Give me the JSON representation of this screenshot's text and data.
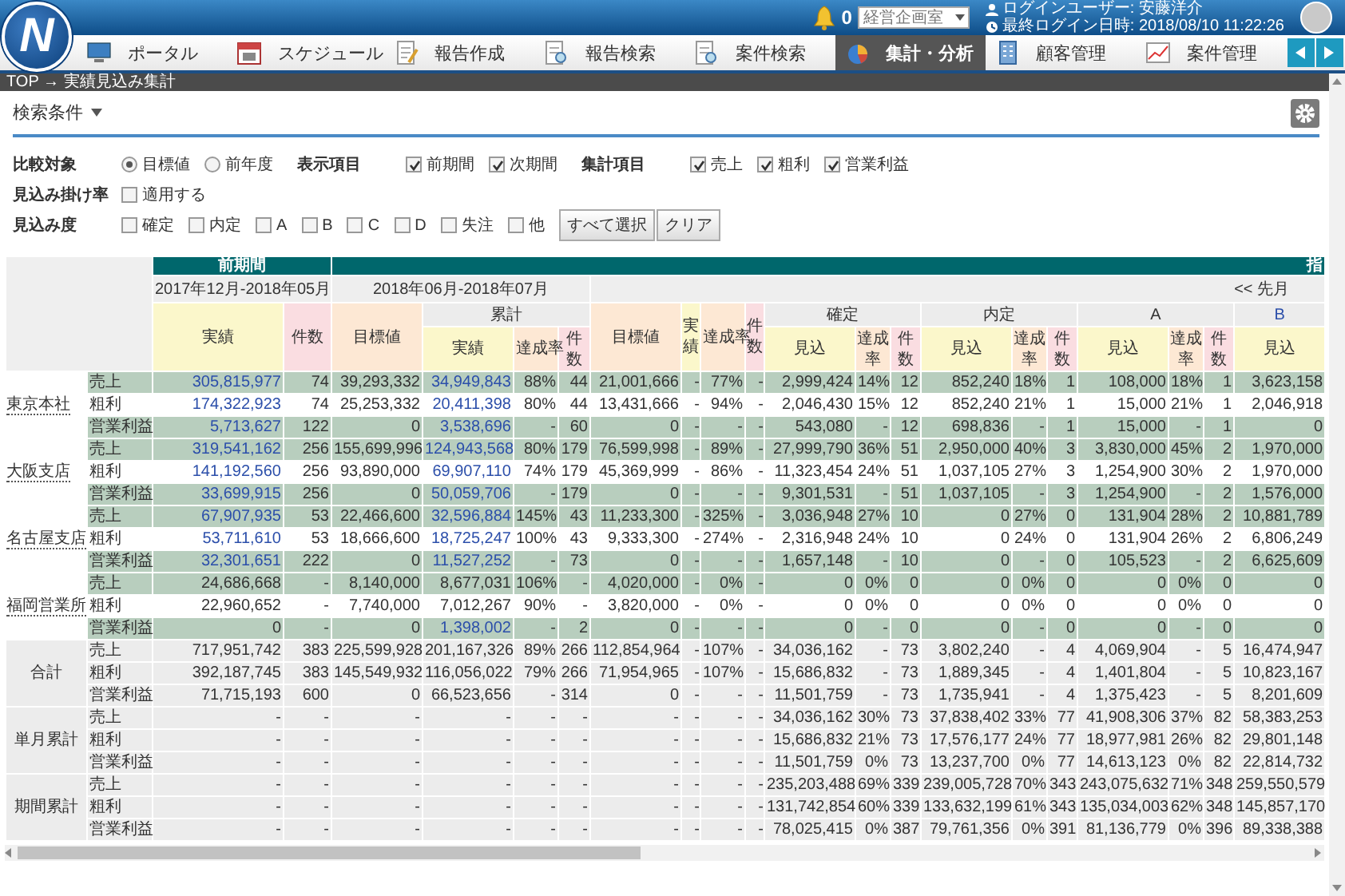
{
  "header": {
    "logo": "N",
    "notifications": "0",
    "department": "経営企画室",
    "user": "ログインユーザー: 安藤洋介",
    "last_login": "最終ログイン日時: 2018/08/10 11:22:26"
  },
  "nav": [
    {
      "label": "ポータル",
      "selected": false
    },
    {
      "label": "スケジュール",
      "selected": false
    },
    {
      "label": "報告作成",
      "selected": false
    },
    {
      "label": "報告検索",
      "selected": false
    },
    {
      "label": "案件検索",
      "selected": false
    },
    {
      "label": "集計・分析",
      "selected": true
    },
    {
      "label": "顧客管理",
      "selected": false
    },
    {
      "label": "案件管理",
      "selected": false
    }
  ],
  "breadcrumb": "TOP → 実績見込み集計",
  "search": {
    "title": "検索条件",
    "filters": [
      {
        "label": "比較対象",
        "options": [
          {
            "kind": "radio",
            "text": "目標値",
            "selected": true
          },
          {
            "kind": "radio",
            "text": "前年度",
            "selected": false
          }
        ]
      },
      {
        "label": "表示項目",
        "options": [
          {
            "kind": "checkbox",
            "text": "前期間",
            "checked": true
          },
          {
            "kind": "checkbox",
            "text": "次期間",
            "checked": true
          }
        ]
      },
      {
        "label": "集計項目",
        "options": [
          {
            "kind": "checkbox",
            "text": "売上",
            "checked": true
          },
          {
            "kind": "checkbox",
            "text": "粗利",
            "checked": true
          },
          {
            "kind": "checkbox",
            "text": "営業利益",
            "checked": true
          }
        ]
      },
      {
        "label": "見込み掛け率",
        "options": [
          {
            "kind": "checkbox",
            "text": "適用する",
            "checked": false
          }
        ]
      },
      {
        "label": "見込み度",
        "options": [
          {
            "kind": "checkbox",
            "text": "確定",
            "checked": false
          },
          {
            "kind": "checkbox",
            "text": "内定",
            "checked": false
          },
          {
            "kind": "checkbox",
            "text": "A",
            "checked": false
          },
          {
            "kind": "checkbox",
            "text": "B",
            "checked": false
          },
          {
            "kind": "checkbox",
            "text": "C",
            "checked": false
          },
          {
            "kind": "checkbox",
            "text": "D",
            "checked": false
          },
          {
            "kind": "checkbox",
            "text": "失注",
            "checked": false
          },
          {
            "kind": "checkbox",
            "text": "他",
            "checked": false
          },
          {
            "kind": "button",
            "text": "すべて選択"
          },
          {
            "kind": "button",
            "text": "クリア"
          }
        ]
      }
    ]
  },
  "table": {
    "periods": [
      {
        "title": "前期間",
        "spans": [
          {
            "range": "2017年12月-2018年05月",
            "column_groups": [
              {
                "label": "実績",
                "kind": "actual"
              },
              {
                "label": "件数",
                "kind": "count"
              }
            ]
          }
        ]
      },
      {
        "title": "指",
        "spans": [
          {
            "range": "2018年06月-2018年07月",
            "column_groups": [
              {
                "label": "目標値",
                "kind": "target"
              },
              {
                "label": "累計",
                "link": false,
                "columns": [
                  {
                    "label": "実績",
                    "kind": "actual"
                  },
                  {
                    "label": "達成率",
                    "kind": "target"
                  },
                  {
                    "label": "件数",
                    "kind": "count"
                  }
                ]
              }
            ]
          },
          {
            "link": "<< 先月",
            "column_groups": [
              {
                "label": "目標値",
                "kind": "target"
              },
              {
                "label": "実績",
                "kind": "actual"
              },
              {
                "label": "達成率",
                "kind": "target"
              },
              {
                "label": "件数",
                "kind": "count"
              },
              {
                "label": "確定",
                "link": false,
                "columns": [
                  {
                    "label": "見込",
                    "kind": "actual"
                  },
                  {
                    "label": "達成率",
                    "kind": "target"
                  },
                  {
                    "label": "件数",
                    "kind": "count"
                  }
                ]
              },
              {
                "label": "内定",
                "link": false,
                "columns": [
                  {
                    "label": "見込",
                    "kind": "actual"
                  },
                  {
                    "label": "達成率",
                    "kind": "target"
                  },
                  {
                    "label": "件数",
                    "kind": "count"
                  }
                ]
              },
              {
                "label": "A",
                "link": false,
                "columns": [
                  {
                    "label": "見込",
                    "kind": "actual"
                  },
                  {
                    "label": "達成率",
                    "kind": "target"
                  },
                  {
                    "label": "件数",
                    "kind": "count"
                  }
                ]
              },
              {
                "label": "B",
                "link": true,
                "columns": [
                  {
                    "label": "見込",
                    "kind": "actual"
                  }
                ]
              }
            ]
          }
        ]
      }
    ],
    "groups": [
      {
        "name": "東京本社",
        "link": true,
        "rows": [
          {
            "label": "売上",
            "kind": "highlight",
            "prev_link": true,
            "cum_link": true,
            "cells": [
              "305,815,977",
              "74",
              "39,293,332",
              "34,949,843",
              "88%",
              "44",
              "21,001,666",
              "-",
              "77%",
              "-",
              "2,999,424",
              "14%",
              "12",
              "852,240",
              "18%",
              "1",
              "108,000",
              "18%",
              "1",
              "3,623,158"
            ]
          },
          {
            "label": "粗利",
            "kind": "plain",
            "prev_link": true,
            "cum_link": true,
            "cells": [
              "174,322,923",
              "74",
              "25,253,332",
              "20,411,398",
              "80%",
              "44",
              "13,431,666",
              "-",
              "94%",
              "-",
              "2,046,430",
              "15%",
              "12",
              "852,240",
              "21%",
              "1",
              "15,000",
              "21%",
              "1",
              "2,046,918"
            ]
          },
          {
            "label": "営業利益",
            "kind": "highlight",
            "prev_link": true,
            "cum_link": true,
            "cells": [
              "5,713,627",
              "122",
              "0",
              "3,538,696",
              "-",
              "60",
              "0",
              "-",
              "-",
              "-",
              "543,080",
              "-",
              "12",
              "698,836",
              "-",
              "1",
              "15,000",
              "-",
              "1",
              "0"
            ]
          }
        ]
      },
      {
        "name": "大阪支店",
        "link": true,
        "rows": [
          {
            "label": "売上",
            "kind": "highlight",
            "prev_link": true,
            "cum_link": true,
            "cells": [
              "319,541,162",
              "256",
              "155,699,996",
              "124,943,568",
              "80%",
              "179",
              "76,599,998",
              "-",
              "89%",
              "-",
              "27,999,790",
              "36%",
              "51",
              "2,950,000",
              "40%",
              "3",
              "3,830,000",
              "45%",
              "2",
              "1,970,000"
            ]
          },
          {
            "label": "粗利",
            "kind": "plain",
            "prev_link": true,
            "cum_link": true,
            "cells": [
              "141,192,560",
              "256",
              "93,890,000",
              "69,907,110",
              "74%",
              "179",
              "45,369,999",
              "-",
              "86%",
              "-",
              "11,323,454",
              "24%",
              "51",
              "1,037,105",
              "27%",
              "3",
              "1,254,900",
              "30%",
              "2",
              "1,970,000"
            ]
          },
          {
            "label": "営業利益",
            "kind": "highlight",
            "prev_link": true,
            "cum_link": true,
            "cells": [
              "33,699,915",
              "256",
              "0",
              "50,059,706",
              "-",
              "179",
              "0",
              "-",
              "-",
              "-",
              "9,301,531",
              "-",
              "51",
              "1,037,105",
              "-",
              "3",
              "1,254,900",
              "-",
              "2",
              "1,576,000"
            ]
          }
        ]
      },
      {
        "name": "名古屋支店",
        "link": true,
        "rows": [
          {
            "label": "売上",
            "kind": "highlight",
            "prev_link": true,
            "cum_link": true,
            "cells": [
              "67,907,935",
              "53",
              "22,466,600",
              "32,596,884",
              "145%",
              "43",
              "11,233,300",
              "-",
              "325%",
              "-",
              "3,036,948",
              "27%",
              "10",
              "0",
              "27%",
              "0",
              "131,904",
              "28%",
              "2",
              "10,881,789"
            ]
          },
          {
            "label": "粗利",
            "kind": "plain",
            "prev_link": true,
            "cum_link": true,
            "cells": [
              "53,711,610",
              "53",
              "18,666,600",
              "18,725,247",
              "100%",
              "43",
              "9,333,300",
              "-",
              "274%",
              "-",
              "2,316,948",
              "24%",
              "10",
              "0",
              "24%",
              "0",
              "131,904",
              "26%",
              "2",
              "6,806,249"
            ]
          },
          {
            "label": "営業利益",
            "kind": "highlight",
            "prev_link": true,
            "cum_link": true,
            "cells": [
              "32,301,651",
              "222",
              "0",
              "11,527,252",
              "-",
              "73",
              "0",
              "-",
              "-",
              "-",
              "1,657,148",
              "-",
              "10",
              "0",
              "-",
              "0",
              "105,523",
              "-",
              "2",
              "6,625,609"
            ]
          }
        ]
      },
      {
        "name": "福岡営業所",
        "link": true,
        "rows": [
          {
            "label": "売上",
            "kind": "highlight",
            "prev_link": false,
            "cum_link": false,
            "cells": [
              "24,686,668",
              "-",
              "8,140,000",
              "8,677,031",
              "106%",
              "-",
              "4,020,000",
              "-",
              "0%",
              "-",
              "0",
              "0%",
              "0",
              "0",
              "0%",
              "0",
              "0",
              "0%",
              "0",
              "0"
            ]
          },
          {
            "label": "粗利",
            "kind": "plain",
            "prev_link": false,
            "cum_link": false,
            "cells": [
              "22,960,652",
              "-",
              "7,740,000",
              "7,012,267",
              "90%",
              "-",
              "3,820,000",
              "-",
              "0%",
              "-",
              "0",
              "0%",
              "0",
              "0",
              "0%",
              "0",
              "0",
              "0%",
              "0",
              "0"
            ]
          },
          {
            "label": "営業利益",
            "kind": "highlight",
            "prev_link": false,
            "cum_link": true,
            "cells": [
              "0",
              "-",
              "0",
              "1,398,002",
              "-",
              "2",
              "0",
              "-",
              "-",
              "-",
              "0",
              "-",
              "0",
              "0",
              "-",
              "0",
              "0",
              "-",
              "0",
              "0"
            ]
          }
        ]
      },
      {
        "name": "合計",
        "link": false,
        "rows": [
          {
            "label": "売上",
            "kind": "summary",
            "prev_link": false,
            "cum_link": false,
            "cells": [
              "717,951,742",
              "383",
              "225,599,928",
              "201,167,326",
              "89%",
              "266",
              "112,854,964",
              "-",
              "107%",
              "-",
              "34,036,162",
              "-",
              "73",
              "3,802,240",
              "-",
              "4",
              "4,069,904",
              "-",
              "5",
              "16,474,947"
            ]
          },
          {
            "label": "粗利",
            "kind": "summary",
            "prev_link": false,
            "cum_link": false,
            "cells": [
              "392,187,745",
              "383",
              "145,549,932",
              "116,056,022",
              "79%",
              "266",
              "71,954,965",
              "-",
              "107%",
              "-",
              "15,686,832",
              "-",
              "73",
              "1,889,345",
              "-",
              "4",
              "1,401,804",
              "-",
              "5",
              "10,823,167"
            ]
          },
          {
            "label": "営業利益",
            "kind": "summary",
            "prev_link": false,
            "cum_link": false,
            "cells": [
              "71,715,193",
              "600",
              "0",
              "66,523,656",
              "-",
              "314",
              "0",
              "-",
              "-",
              "-",
              "11,501,759",
              "-",
              "73",
              "1,735,941",
              "-",
              "4",
              "1,375,423",
              "-",
              "5",
              "8,201,609"
            ]
          }
        ]
      },
      {
        "name": "単月累計",
        "link": false,
        "rows": [
          {
            "label": "売上",
            "kind": "summary",
            "prev_link": false,
            "cum_link": false,
            "cells": [
              "-",
              "-",
              "-",
              "-",
              "-",
              "-",
              "-",
              "-",
              "-",
              "-",
              "34,036,162",
              "30%",
              "73",
              "37,838,402",
              "33%",
              "77",
              "41,908,306",
              "37%",
              "82",
              "58,383,253"
            ]
          },
          {
            "label": "粗利",
            "kind": "summary",
            "prev_link": false,
            "cum_link": false,
            "cells": [
              "-",
              "-",
              "-",
              "-",
              "-",
              "-",
              "-",
              "-",
              "-",
              "-",
              "15,686,832",
              "21%",
              "73",
              "17,576,177",
              "24%",
              "77",
              "18,977,981",
              "26%",
              "82",
              "29,801,148"
            ]
          },
          {
            "label": "営業利益",
            "kind": "summary",
            "prev_link": false,
            "cum_link": false,
            "cells": [
              "-",
              "-",
              "-",
              "-",
              "-",
              "-",
              "-",
              "-",
              "-",
              "-",
              "11,501,759",
              "0%",
              "73",
              "13,237,700",
              "0%",
              "77",
              "14,613,123",
              "0%",
              "82",
              "22,814,732"
            ]
          }
        ]
      },
      {
        "name": "期間累計",
        "link": false,
        "rows": [
          {
            "label": "売上",
            "kind": "summary",
            "prev_link": false,
            "cum_link": false,
            "cells": [
              "-",
              "-",
              "-",
              "-",
              "-",
              "-",
              "-",
              "-",
              "-",
              "-",
              "235,203,488",
              "69%",
              "339",
              "239,005,728",
              "70%",
              "343",
              "243,075,632",
              "71%",
              "348",
              "259,550,579"
            ]
          },
          {
            "label": "粗利",
            "kind": "summary",
            "prev_link": false,
            "cum_link": false,
            "cells": [
              "-",
              "-",
              "-",
              "-",
              "-",
              "-",
              "-",
              "-",
              "-",
              "-",
              "131,742,854",
              "60%",
              "339",
              "133,632,199",
              "61%",
              "343",
              "135,034,003",
              "62%",
              "348",
              "145,857,170"
            ]
          },
          {
            "label": "営業利益",
            "kind": "summary",
            "prev_link": false,
            "cum_link": false,
            "cells": [
              "-",
              "-",
              "-",
              "-",
              "-",
              "-",
              "-",
              "-",
              "-",
              "-",
              "78,025,415",
              "0%",
              "387",
              "79,761,356",
              "0%",
              "391",
              "81,136,779",
              "0%",
              "396",
              "89,338,388"
            ]
          }
        ]
      }
    ]
  }
}
